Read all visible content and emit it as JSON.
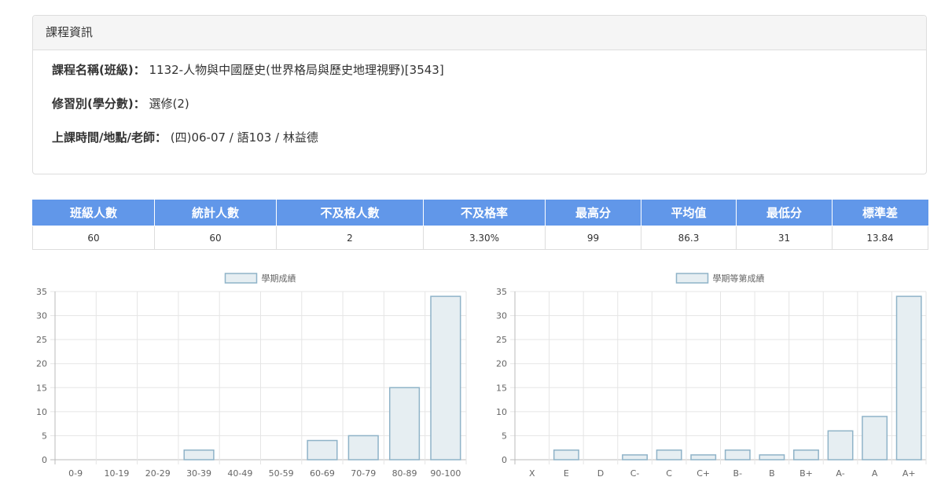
{
  "course_panel": {
    "heading": "課程資訊",
    "rows": [
      {
        "label": "課程名稱(班級)：",
        "value": "1132-人物與中國歷史(世界格局與歷史地理視野)[3543]"
      },
      {
        "label": "修習別(學分數)：",
        "value": "選修(2)"
      },
      {
        "label": "上課時間/地點/老師：",
        "value": "(四)06-07 / 語103 / 林益德"
      }
    ]
  },
  "stats_table": {
    "headers": [
      "班級人數",
      "統計人數",
      "不及格人數",
      "不及格率",
      "最高分",
      "平均值",
      "最低分",
      "標準差"
    ],
    "values": [
      "60",
      "60",
      "2",
      "3.30%",
      "99",
      "86.3",
      "31",
      "13.84"
    ]
  },
  "colors": {
    "table_header_bg": "#6197e9",
    "bar_fill": "#e6eef2",
    "bar_stroke": "#8fb3c8",
    "grid": "#e5e5e5"
  },
  "chart_data": [
    {
      "type": "bar",
      "legend": "學期成績",
      "legend_position": "top",
      "categories": [
        "0-9",
        "10-19",
        "20-29",
        "30-39",
        "40-49",
        "50-59",
        "60-69",
        "70-79",
        "80-89",
        "90-100"
      ],
      "values": [
        0,
        0,
        0,
        2,
        0,
        0,
        4,
        5,
        15,
        34
      ],
      "ylim": [
        0,
        35
      ],
      "yticks": [
        0,
        5,
        10,
        15,
        20,
        25,
        30,
        35
      ],
      "grid": true
    },
    {
      "type": "bar",
      "legend": "學期等第成績",
      "legend_position": "top",
      "categories": [
        "X",
        "E",
        "D",
        "C-",
        "C",
        "C+",
        "B-",
        "B",
        "B+",
        "A-",
        "A",
        "A+"
      ],
      "values": [
        0,
        2,
        0,
        1,
        2,
        1,
        2,
        1,
        2,
        6,
        9,
        34
      ],
      "ylim": [
        0,
        35
      ],
      "yticks": [
        0,
        5,
        10,
        15,
        20,
        25,
        30,
        35
      ],
      "grid": true
    }
  ]
}
